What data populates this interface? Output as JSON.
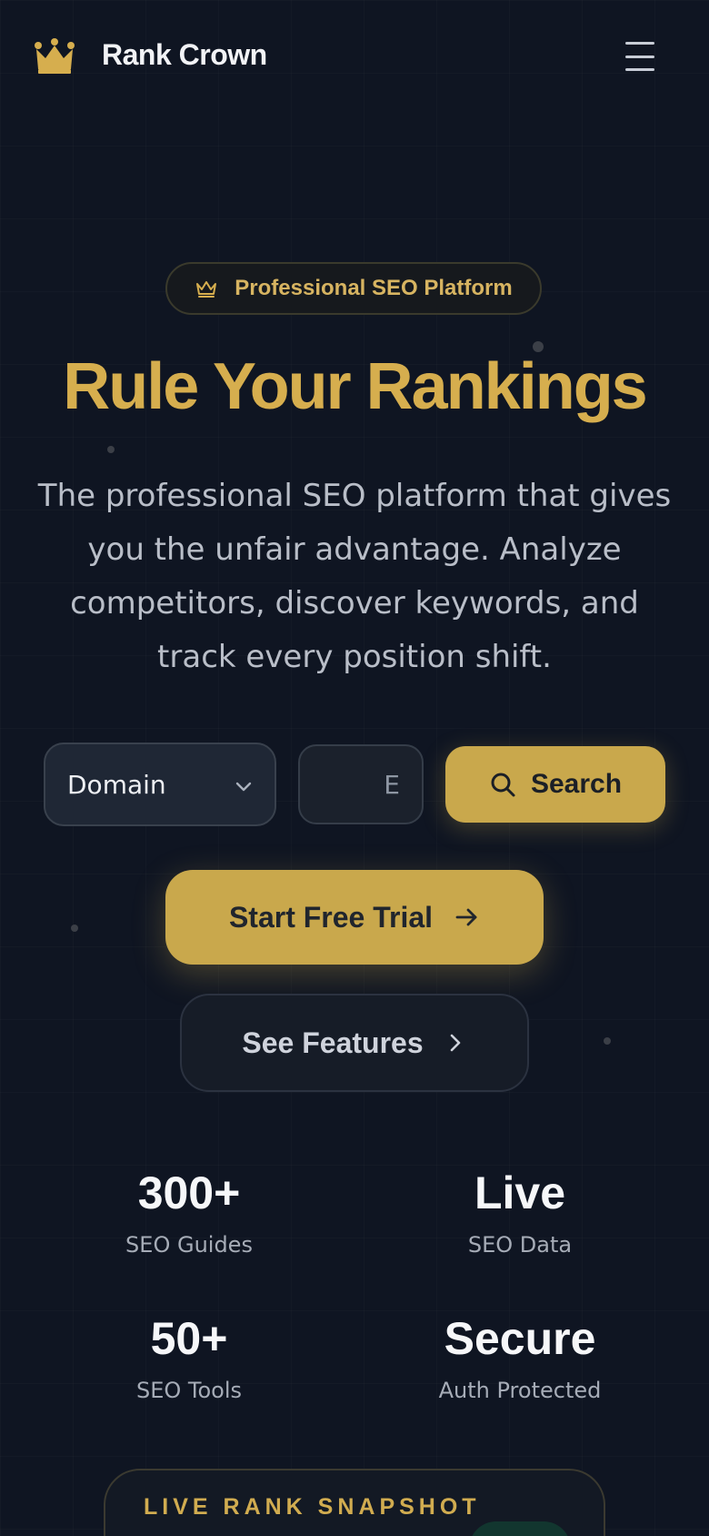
{
  "header": {
    "brand": "Rank Crown",
    "logo_icon": "crown-icon",
    "menu_icon": "hamburger-menu-icon"
  },
  "badge": {
    "icon": "crown-outline-icon",
    "label": "Professional SEO Platform"
  },
  "hero": {
    "title": "Rule Your Rankings",
    "subtitle": "The professional SEO platform that gives you the unfair advantage. Analyze competitors, discover keywords, and track every position shift."
  },
  "search": {
    "mode_selected": "Domain",
    "input_placeholder": "E",
    "button_label": "Search"
  },
  "cta": {
    "primary_label": "Start Free Trial",
    "secondary_label": "See Features"
  },
  "stats": [
    {
      "value": "300+",
      "caption": "SEO Guides"
    },
    {
      "value": "Live",
      "caption": "SEO Data"
    },
    {
      "value": "50+",
      "caption": "SEO Tools"
    },
    {
      "value": "Secure",
      "caption": "Auth Protected"
    }
  ],
  "snapshot": {
    "title": "LIVE RANK SNAPSHOT"
  },
  "colors": {
    "background": "#0f1522",
    "accent_gold": "#c9a84c",
    "title_gold": "#d6ae4e",
    "text_muted": "#b9bec8"
  }
}
